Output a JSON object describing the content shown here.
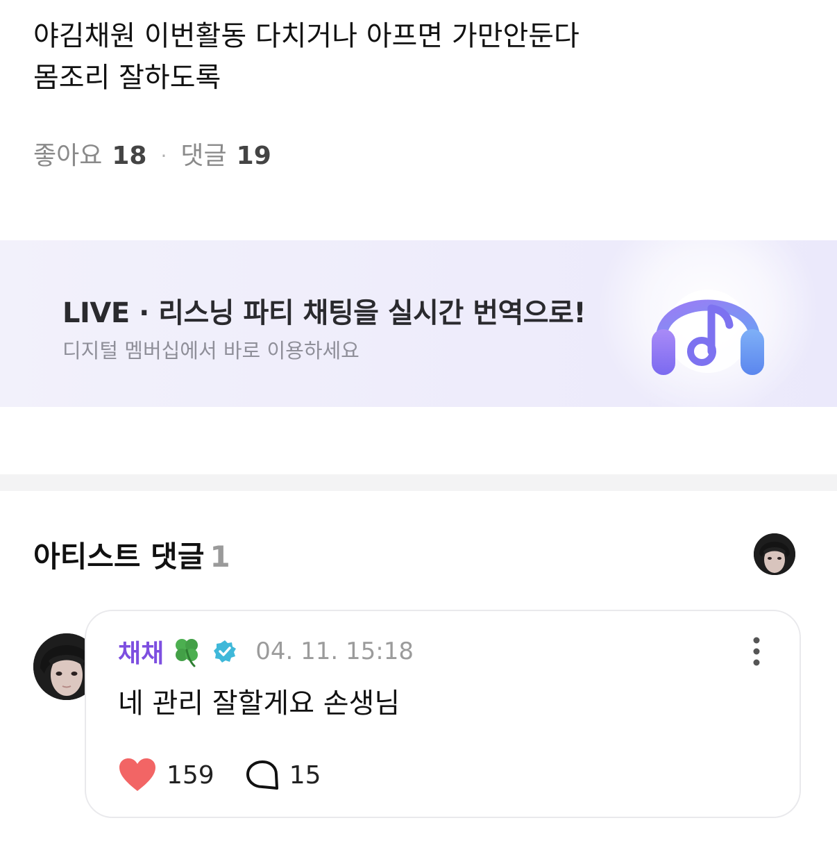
{
  "post": {
    "lines": [
      "야김채원 이번활동 다치거나 아프면 가만안둔다",
      "몸조리 잘하도록"
    ],
    "likes_label": "좋아요",
    "likes_count": "18",
    "separator": "·",
    "comments_label": "댓글",
    "comments_count": "19"
  },
  "banner": {
    "title": "LIVE · 리스닝 파티 채팅을 실시간 번역으로!",
    "subtitle": "디지털 멤버십에서 바로 이용하세요",
    "icon": "headphones-music-note-icon"
  },
  "artist_comments": {
    "title": "아티스트 댓글",
    "count": "1"
  },
  "comment": {
    "author": "채채",
    "author_emoji_icon": "four-leaf-clover-icon",
    "verified_icon": "verified-badge-icon",
    "time": "04. 11. 15:18",
    "text": "네 관리 잘할게요 손생님",
    "likes": "159",
    "replies": "15"
  },
  "colors": {
    "author": "#7d4fe0",
    "heart": "#f26565",
    "verified": "#3fb8d9",
    "banner_bg": "#eeecfb"
  }
}
